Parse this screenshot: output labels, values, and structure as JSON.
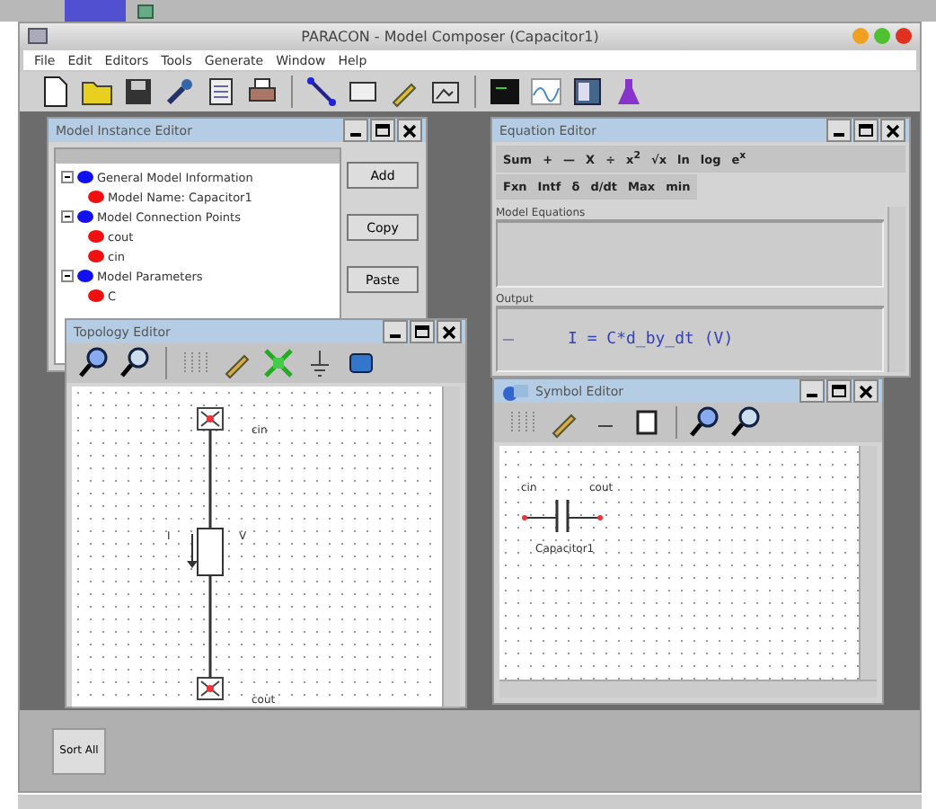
{
  "app": {
    "title": "PARACON - Model Composer (Capacitor1)"
  },
  "menu": [
    "File",
    "Edit",
    "Editors",
    "Tools",
    "Generate",
    "Window",
    "Help"
  ],
  "instance_editor": {
    "title": "Model Instance Editor",
    "tree": [
      {
        "label": "General Model Information",
        "color": "#1010f0",
        "children": [
          {
            "label": "Model Name: Capacitor1",
            "color": "#f01010"
          }
        ]
      },
      {
        "label": "Model Connection Points",
        "color": "#1010f0",
        "children": [
          {
            "label": "cout",
            "color": "#f01010"
          },
          {
            "label": "cin",
            "color": "#f01010"
          }
        ]
      },
      {
        "label": "Model Parameters",
        "color": "#1010f0",
        "children": [
          {
            "label": "C",
            "color": "#f01010"
          }
        ]
      }
    ],
    "buttons": [
      "Add",
      "Copy",
      "Paste"
    ]
  },
  "equation_editor": {
    "title": "Equation Editor",
    "toolbar_rows": [
      [
        "Sum",
        "+",
        "—",
        "X",
        "÷",
        "x$^{2}$",
        "√x",
        "ln",
        "log",
        "e$^{x}$"
      ],
      [
        "Fxn",
        "Intf",
        "δ",
        "d/dt",
        "Max",
        "min"
      ]
    ],
    "sections": [
      {
        "label": "Model Equations"
      },
      {
        "label": "Output",
        "equation": "I  =  C*d_by_dt (V)"
      }
    ]
  },
  "topology_editor": {
    "title": "Topology Editor",
    "pin_top": "cin",
    "pin_bottom": "cout",
    "current": "I",
    "voltage": "V"
  },
  "symbol_editor": {
    "title": "Symbol Editor",
    "pin_left": "cin",
    "pin_right": "cout",
    "name": "Capacitor1"
  },
  "taskbar": {
    "button": "Sort All"
  }
}
